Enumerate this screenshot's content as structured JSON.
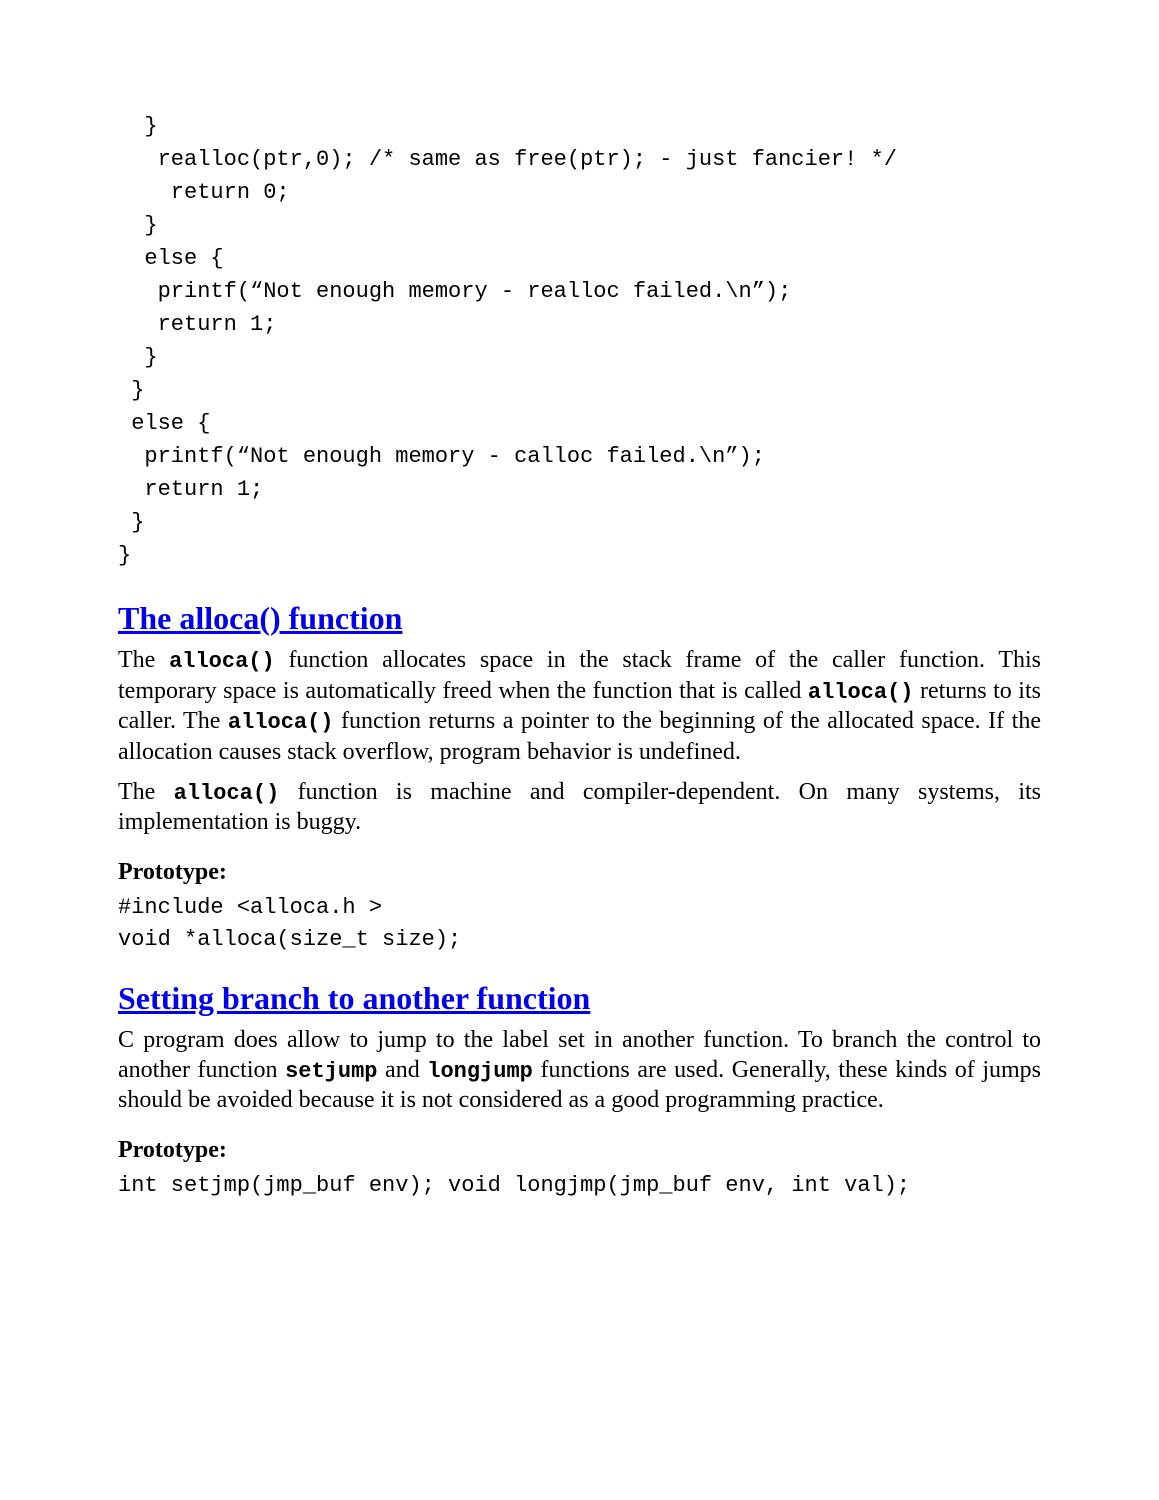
{
  "code1": "  }\n   realloc(ptr,0); /* same as free(ptr); - just fancier! */\n    return 0;\n  }\n  else {\n   printf(“Not enough memory - realloc failed.\\n”);\n   return 1;\n  }\n }\n else {\n  printf(“Not enough memory - calloc failed.\\n”);\n  return 1;\n }\n}",
  "section1": {
    "heading": "The alloca() function",
    "para1_a": "The ",
    "para1_code1": "alloca()",
    "para1_b": " function allocates space in the stack frame of the caller function. This temporary space is automatically freed when the function that is called ",
    "para1_code2": "alloca()",
    "para1_c": " returns to its caller. The ",
    "para1_code3": "alloca()",
    "para1_d": " function returns a pointer to the beginning of the allocated space. If the allocation causes stack overflow, program behavior is undefined.",
    "para2_a": "The ",
    "para2_code1": "alloca()",
    "para2_b": " function is machine and compiler-dependent. On many systems, its implementation is buggy.",
    "proto_label": "Prototype:",
    "proto_code": "#include <alloca.h >\nvoid *alloca(size_t size);"
  },
  "section2": {
    "heading": "Setting branch to another function",
    "para1_a": "C program does allow to jump to the label set in another function. To branch the control to another function ",
    "para1_code1": "setjump",
    "para1_b": " and ",
    "para1_code2": "longjump",
    "para1_c": " functions are used. Generally, these kinds of jumps should be avoided because it is not considered as a good programming practice.",
    "proto_label": "Prototype:",
    "proto_code": "int setjmp(jmp_buf env); void longjmp(jmp_buf env, int val);"
  }
}
